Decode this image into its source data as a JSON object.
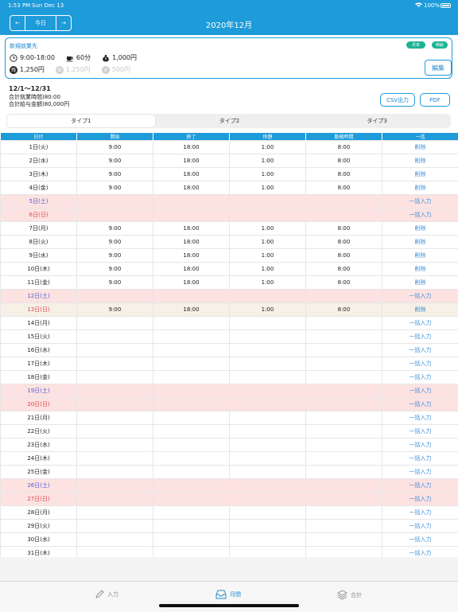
{
  "status": {
    "time": "1:53 PM",
    "date": "Sun Dec 13",
    "battery": "100%"
  },
  "nav": {
    "prev": "←",
    "today": "今日",
    "next": "→",
    "title": "2020年12月"
  },
  "card": {
    "name": "新規就業先",
    "badges": [
      "月末",
      "時給"
    ],
    "hours": "9:00-18:00",
    "break": "60分",
    "rate": "1,000円",
    "overtime": "1,250円",
    "holiday": "1,250円",
    "extra": "500円",
    "edit_label": "編集"
  },
  "summary": {
    "range": "12/1〜12/31",
    "total_hours": "合計就業時間)80:00",
    "total_pay": "合計給与金額)80,000円"
  },
  "actions": {
    "csv": "CSV出力",
    "pdf": "PDF"
  },
  "tabs": [
    "タイプ1",
    "タイプ2",
    "タイプ3"
  ],
  "table": {
    "headers": [
      "日付",
      "開始",
      "終了",
      "休憩",
      "勤務時間",
      "一括"
    ],
    "rows": [
      {
        "date": "1日(火)",
        "start": "9:00",
        "end": "18:00",
        "rest": "1:00",
        "work": "8:00",
        "action": "削除",
        "type": "normal"
      },
      {
        "date": "2日(水)",
        "start": "9:00",
        "end": "18:00",
        "rest": "1:00",
        "work": "8:00",
        "action": "削除",
        "type": "normal"
      },
      {
        "date": "3日(木)",
        "start": "9:00",
        "end": "18:00",
        "rest": "1:00",
        "work": "8:00",
        "action": "削除",
        "type": "normal"
      },
      {
        "date": "4日(金)",
        "start": "9:00",
        "end": "18:00",
        "rest": "1:00",
        "work": "8:00",
        "action": "削除",
        "type": "normal"
      },
      {
        "date": "5日(土)",
        "start": "",
        "end": "",
        "rest": "",
        "work": "",
        "action": "一括入力",
        "type": "sat"
      },
      {
        "date": "6日(日)",
        "start": "",
        "end": "",
        "rest": "",
        "work": "",
        "action": "一括入力",
        "type": "sun"
      },
      {
        "date": "7日(月)",
        "start": "9:00",
        "end": "18:00",
        "rest": "1:00",
        "work": "8:00",
        "action": "削除",
        "type": "normal"
      },
      {
        "date": "8日(火)",
        "start": "9:00",
        "end": "18:00",
        "rest": "1:00",
        "work": "8:00",
        "action": "削除",
        "type": "normal"
      },
      {
        "date": "9日(水)",
        "start": "9:00",
        "end": "18:00",
        "rest": "1:00",
        "work": "8:00",
        "action": "削除",
        "type": "normal"
      },
      {
        "date": "10日(木)",
        "start": "9:00",
        "end": "18:00",
        "rest": "1:00",
        "work": "8:00",
        "action": "削除",
        "type": "normal"
      },
      {
        "date": "11日(金)",
        "start": "9:00",
        "end": "18:00",
        "rest": "1:00",
        "work": "8:00",
        "action": "削除",
        "type": "normal"
      },
      {
        "date": "12日(土)",
        "start": "",
        "end": "",
        "rest": "",
        "work": "",
        "action": "一括入力",
        "type": "sat"
      },
      {
        "date": "13日(日)",
        "start": "9:00",
        "end": "18:00",
        "rest": "1:00",
        "work": "8:00",
        "action": "削除",
        "type": "today"
      },
      {
        "date": "14日(月)",
        "start": "",
        "end": "",
        "rest": "",
        "work": "",
        "action": "一括入力",
        "type": "normal"
      },
      {
        "date": "15日(火)",
        "start": "",
        "end": "",
        "rest": "",
        "work": "",
        "action": "一括入力",
        "type": "normal"
      },
      {
        "date": "16日(水)",
        "start": "",
        "end": "",
        "rest": "",
        "work": "",
        "action": "一括入力",
        "type": "normal"
      },
      {
        "date": "17日(木)",
        "start": "",
        "end": "",
        "rest": "",
        "work": "",
        "action": "一括入力",
        "type": "normal"
      },
      {
        "date": "18日(金)",
        "start": "",
        "end": "",
        "rest": "",
        "work": "",
        "action": "一括入力",
        "type": "normal"
      },
      {
        "date": "19日(土)",
        "start": "",
        "end": "",
        "rest": "",
        "work": "",
        "action": "一括入力",
        "type": "sat"
      },
      {
        "date": "20日(日)",
        "start": "",
        "end": "",
        "rest": "",
        "work": "",
        "action": "一括入力",
        "type": "sun"
      },
      {
        "date": "21日(月)",
        "start": "",
        "end": "",
        "rest": "",
        "work": "",
        "action": "一括入力",
        "type": "normal"
      },
      {
        "date": "22日(火)",
        "start": "",
        "end": "",
        "rest": "",
        "work": "",
        "action": "一括入力",
        "type": "normal"
      },
      {
        "date": "23日(水)",
        "start": "",
        "end": "",
        "rest": "",
        "work": "",
        "action": "一括入力",
        "type": "normal"
      },
      {
        "date": "24日(木)",
        "start": "",
        "end": "",
        "rest": "",
        "work": "",
        "action": "一括入力",
        "type": "normal"
      },
      {
        "date": "25日(金)",
        "start": "",
        "end": "",
        "rest": "",
        "work": "",
        "action": "一括入力",
        "type": "normal"
      },
      {
        "date": "26日(土)",
        "start": "",
        "end": "",
        "rest": "",
        "work": "",
        "action": "一括入力",
        "type": "sat"
      },
      {
        "date": "27日(日)",
        "start": "",
        "end": "",
        "rest": "",
        "work": "",
        "action": "一括入力",
        "type": "sun"
      },
      {
        "date": "28日(月)",
        "start": "",
        "end": "",
        "rest": "",
        "work": "",
        "action": "一括入力",
        "type": "normal"
      },
      {
        "date": "29日(火)",
        "start": "",
        "end": "",
        "rest": "",
        "work": "",
        "action": "一括入力",
        "type": "normal"
      },
      {
        "date": "30日(水)",
        "start": "",
        "end": "",
        "rest": "",
        "work": "",
        "action": "一括入力",
        "type": "normal"
      },
      {
        "date": "31日(木)",
        "start": "",
        "end": "",
        "rest": "",
        "work": "",
        "action": "一括入力",
        "type": "normal"
      }
    ]
  },
  "tabbar": [
    {
      "label": "入力",
      "icon": "pencil-icon",
      "selected": false
    },
    {
      "label": "月間",
      "icon": "tray-icon",
      "selected": true
    },
    {
      "label": "合計",
      "icon": "layers-icon",
      "selected": false
    }
  ],
  "colors": {
    "accent": "#1e9bd9",
    "weekend_bg": "#fde2e2",
    "today_bg": "#f6f0e7",
    "saturday": "#4a5bd8",
    "sunday": "#e04444",
    "link": "#3d8fd6",
    "badge": "#1ab394"
  }
}
